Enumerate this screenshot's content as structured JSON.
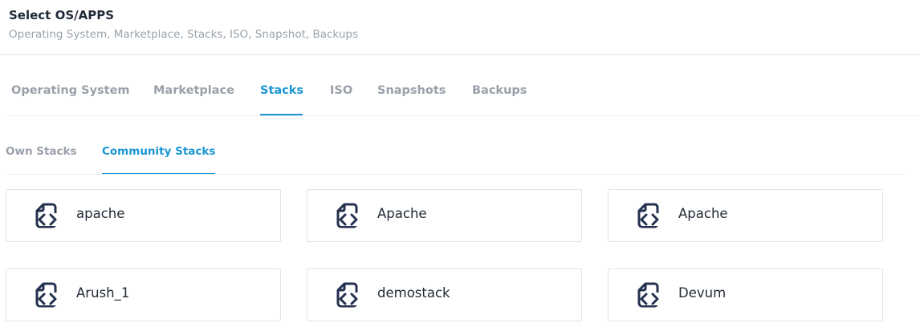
{
  "header": {
    "title": "Select OS/APPS",
    "subtitle": "Operating System, Marketplace, Stacks, ISO, Snapshot, Backups"
  },
  "tabs": [
    {
      "label": "Operating System",
      "active": false
    },
    {
      "label": "Marketplace",
      "active": false
    },
    {
      "label": "Stacks",
      "active": true
    },
    {
      "label": "ISO",
      "active": false
    },
    {
      "label": "Snapshots",
      "active": false
    },
    {
      "label": "Backups",
      "active": false
    }
  ],
  "subtabs": [
    {
      "label": "Own Stacks",
      "active": false
    },
    {
      "label": "Community Stacks",
      "active": true
    }
  ],
  "stacks": [
    {
      "name": "apache",
      "icon": "code-file-icon"
    },
    {
      "name": "Apache",
      "icon": "code-file-icon"
    },
    {
      "name": "Apache",
      "icon": "code-file-icon"
    },
    {
      "name": "Arush_1",
      "icon": "code-file-icon"
    },
    {
      "name": "demostack",
      "icon": "code-file-icon"
    },
    {
      "name": "Devum",
      "icon": "code-file-icon"
    }
  ],
  "colors": {
    "accent": "#1a96d4",
    "inactive_tab": "#9aa0aa",
    "title": "#1f2937",
    "icon": "#24314f"
  }
}
